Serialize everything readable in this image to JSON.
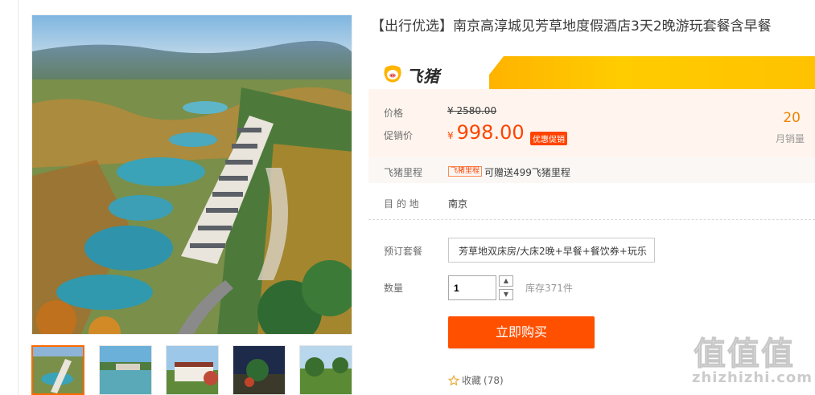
{
  "product": {
    "title": "【出行优选】南京高淳城见芳草地度假酒店3天2晚游玩套餐含早餐"
  },
  "banner": {
    "brand": "飞猪",
    "logo_icon": "fliggy-pig-icon",
    "accent": "#ffc400"
  },
  "price": {
    "label_original": "价格",
    "original": "¥ 2580.00",
    "label_sale": "促销价",
    "currency": "¥",
    "sale": "998.00",
    "promo_tag": "优惠促销",
    "sale_color": "#ff4400"
  },
  "monthly": {
    "count": "20",
    "label": "月销量"
  },
  "points": {
    "label": "飞猪里程",
    "tag": "飞猪里程",
    "text": "可赠送499飞猪里程"
  },
  "destination": {
    "label": "目 的 地",
    "value": "南京"
  },
  "package": {
    "label": "预订套餐",
    "selected": "芳草地双床房/大床2晚+早餐+餐饮券+玩乐"
  },
  "quantity": {
    "label": "数量",
    "value": "1",
    "up_icon": "caret-up-icon",
    "down_icon": "caret-down-icon",
    "stock": "库存371件"
  },
  "actions": {
    "buy": "立即购买",
    "favorite": "收藏",
    "favorite_count": "(78)",
    "buy_color": "#ff5000"
  },
  "watermark": {
    "glyphs": "值值值",
    "url": "zhizhizhi.com"
  }
}
